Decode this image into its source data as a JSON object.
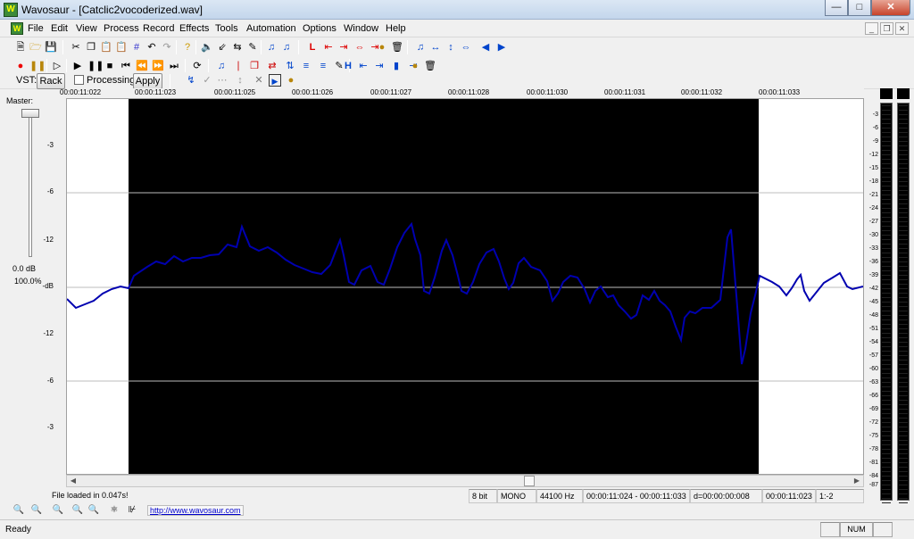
{
  "window": {
    "title": "Wavosaur - [Catclic2vocoderized.wav]",
    "app_icon": "wavosaur-icon",
    "controls": [
      "minimize",
      "maximize",
      "close"
    ]
  },
  "menu": [
    "File",
    "Edit",
    "View",
    "Process",
    "Record",
    "Effects",
    "Tools",
    "Automation",
    "Options",
    "Window",
    "Help"
  ],
  "vst": {
    "label": "VST:",
    "rack_button": "Rack",
    "processing_label": "Processing",
    "processing_checked": false,
    "apply_button": "Apply"
  },
  "ruler": [
    "00:00:11:022",
    "00:00:11:023",
    "00:00:11:025",
    "00:00:11:026",
    "00:00:11:027",
    "00:00:11:028",
    "00:00:11:030",
    "00:00:11:031",
    "00:00:11:032",
    "00:00:11:033"
  ],
  "master": {
    "label": "Master:",
    "scale": [
      "-3",
      "-6",
      "-12",
      "-12"
    ],
    "db": "0.0 dB",
    "percent": "100.0%"
  },
  "waveform": {
    "left_scale": [
      "-3",
      "-6",
      "-12",
      "-dB",
      "-12",
      "-6",
      "-3"
    ],
    "selection_color": "#000000",
    "wave_color": "#0000b0",
    "grid_color": "#bdbdbd",
    "background": "#ffffff"
  },
  "right_scale": [
    "-3",
    "-6",
    "-9",
    "-12",
    "-15",
    "-18",
    "-21",
    "-24",
    "-27",
    "-30",
    "-33",
    "-36",
    "-39",
    "-42",
    "-45",
    "-48",
    "-51",
    "-54",
    "-57",
    "-60",
    "-63",
    "-66",
    "-69",
    "-72",
    "-75",
    "-78",
    "-81",
    "-84",
    "-87"
  ],
  "status": {
    "message": "File loaded in 0.047s!",
    "bits": "8 bit",
    "channels": "MONO",
    "rate": "44100 Hz",
    "selection": "00:00:11:024 - 00:00:11:033",
    "duration": "d=00:00:00:008",
    "position": "00:00:11:023",
    "zoom": "1:-2"
  },
  "link": "http://www.wavosaur.com",
  "statusbar": {
    "ready": "Ready",
    "num": "NUM"
  }
}
